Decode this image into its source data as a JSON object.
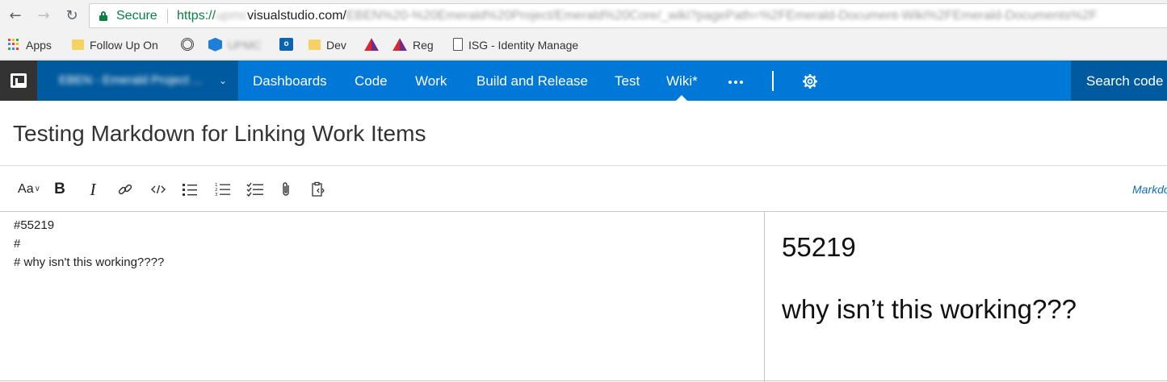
{
  "browser": {
    "nav": {
      "back_icon": "arrow-left-icon",
      "forward_icon": "arrow-right-icon",
      "reload_icon": "reload-icon"
    },
    "address_bar": {
      "secure_label": "Secure",
      "scheme": "https://",
      "host_redacted": "upmc",
      "host_visible": "visualstudio.com/",
      "path_redacted": "EBEN%20-%20Emerald%20Project/Emerald%20Core/_wiki?pagePath=%2FEmerald-Document-Wiki%2FEmerald-Documents%2F"
    },
    "bookmarks": [
      {
        "label": "Apps",
        "icon": "apps-grid-icon"
      },
      {
        "label": "Follow Up On",
        "icon": "folder-icon"
      },
      {
        "label": "",
        "icon": "spiral-icon"
      },
      {
        "label": "UPMC",
        "icon": "azure-devops-icon"
      },
      {
        "label": "",
        "icon": "outlook-icon"
      },
      {
        "label": "Dev",
        "icon": "folder-icon"
      },
      {
        "label": "",
        "icon": "triangle-logo-icon"
      },
      {
        "label": "Reg",
        "icon": "triangle-logo-icon"
      },
      {
        "label": "ISG - Identity Manage",
        "icon": "document-icon"
      }
    ]
  },
  "header": {
    "logo_icon": "visual-studio-logo-icon",
    "project_name": "EBEN - Emerald Project ...",
    "hubs": [
      "Dashboards",
      "Code",
      "Work",
      "Build and Release",
      "Test",
      "Wiki*"
    ],
    "active_hub": "Wiki*",
    "more_icon": "ellipsis-icon",
    "settings_icon": "gear-icon",
    "search_placeholder": "Search code"
  },
  "page": {
    "title": "Testing Markdown for Linking Work Items"
  },
  "toolbar": {
    "heading_label": "Aa",
    "bold_label": "B",
    "italic_label": "I",
    "icons": [
      "link-icon",
      "code-icon",
      "bulleted-list-icon",
      "numbered-list-icon",
      "task-list-icon",
      "attachment-icon",
      "paste-code-icon"
    ],
    "mode_label": "Markdown"
  },
  "editor": {
    "lines": [
      "#55219",
      "#",
      "# why isn't this working????"
    ]
  },
  "preview": {
    "headings": [
      "55219",
      "why isn’t this working???"
    ]
  }
}
